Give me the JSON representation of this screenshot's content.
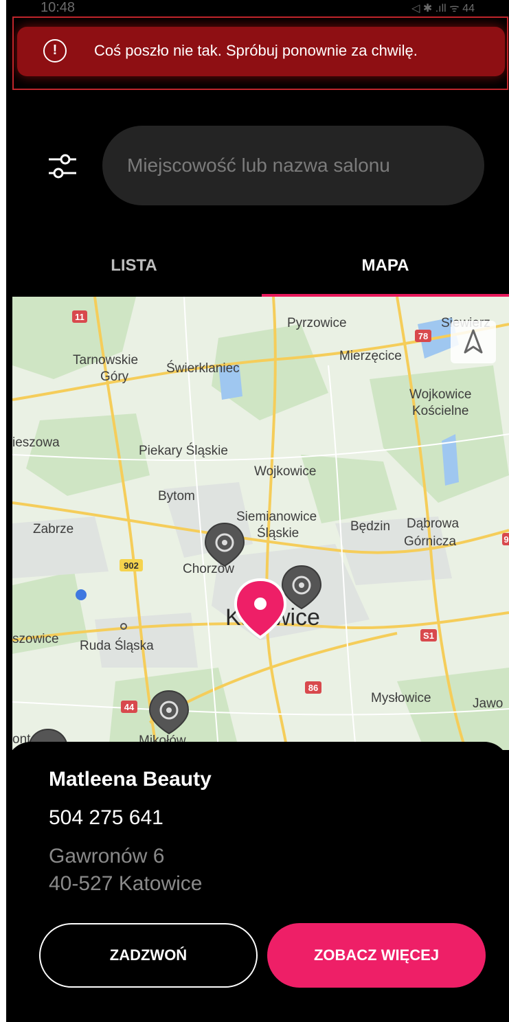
{
  "status_bar": {
    "time": "10:48",
    "right": "◁ ✱ .ıll ᯤ 44"
  },
  "toast": {
    "icon": "alert-circle-icon",
    "message": "Coś poszło nie tak. Spróbuj ponownie za chwilę."
  },
  "search": {
    "placeholder": "Miejscowość lub nazwa salonu",
    "filter_icon": "sliders-icon"
  },
  "tabs": [
    {
      "label": "LISTA"
    },
    {
      "label": "MAPA"
    }
  ],
  "map": {
    "labels": [
      "Pyrzowice",
      "Siewierz",
      "Tarnowskie",
      "Góry",
      "Świerklaniec",
      "Mierzęcice",
      "Wojkowice",
      "Kościelne",
      "ieszowa",
      "Piekary Śląskie",
      "Wojkowice",
      "Bytom",
      "Siemianowice",
      "Śląskie",
      "Zabrze",
      "Będzin",
      "Dąbrowa",
      "Górnicza",
      "Chorzów",
      "Katowice",
      "szowice",
      "Ruda Śląska",
      "Mysłowice",
      "Jawo",
      "Mikołów",
      "ont"
    ],
    "road_badges": [
      "11",
      "78",
      "902",
      "S1",
      "86",
      "44",
      "9"
    ],
    "compass_icon": "navigation-arrow-icon"
  },
  "salon": {
    "name": "Matleena Beauty",
    "phone": "504 275 641",
    "street": "Gawronów 6",
    "city": "40-527 Katowice"
  },
  "buttons": {
    "call": "ZADZWOŃ",
    "more": "ZOBACZ WIĘCEJ"
  },
  "colors": {
    "accent": "#ee1f67",
    "toast_bg": "#8e0f13",
    "background": "#000000"
  }
}
